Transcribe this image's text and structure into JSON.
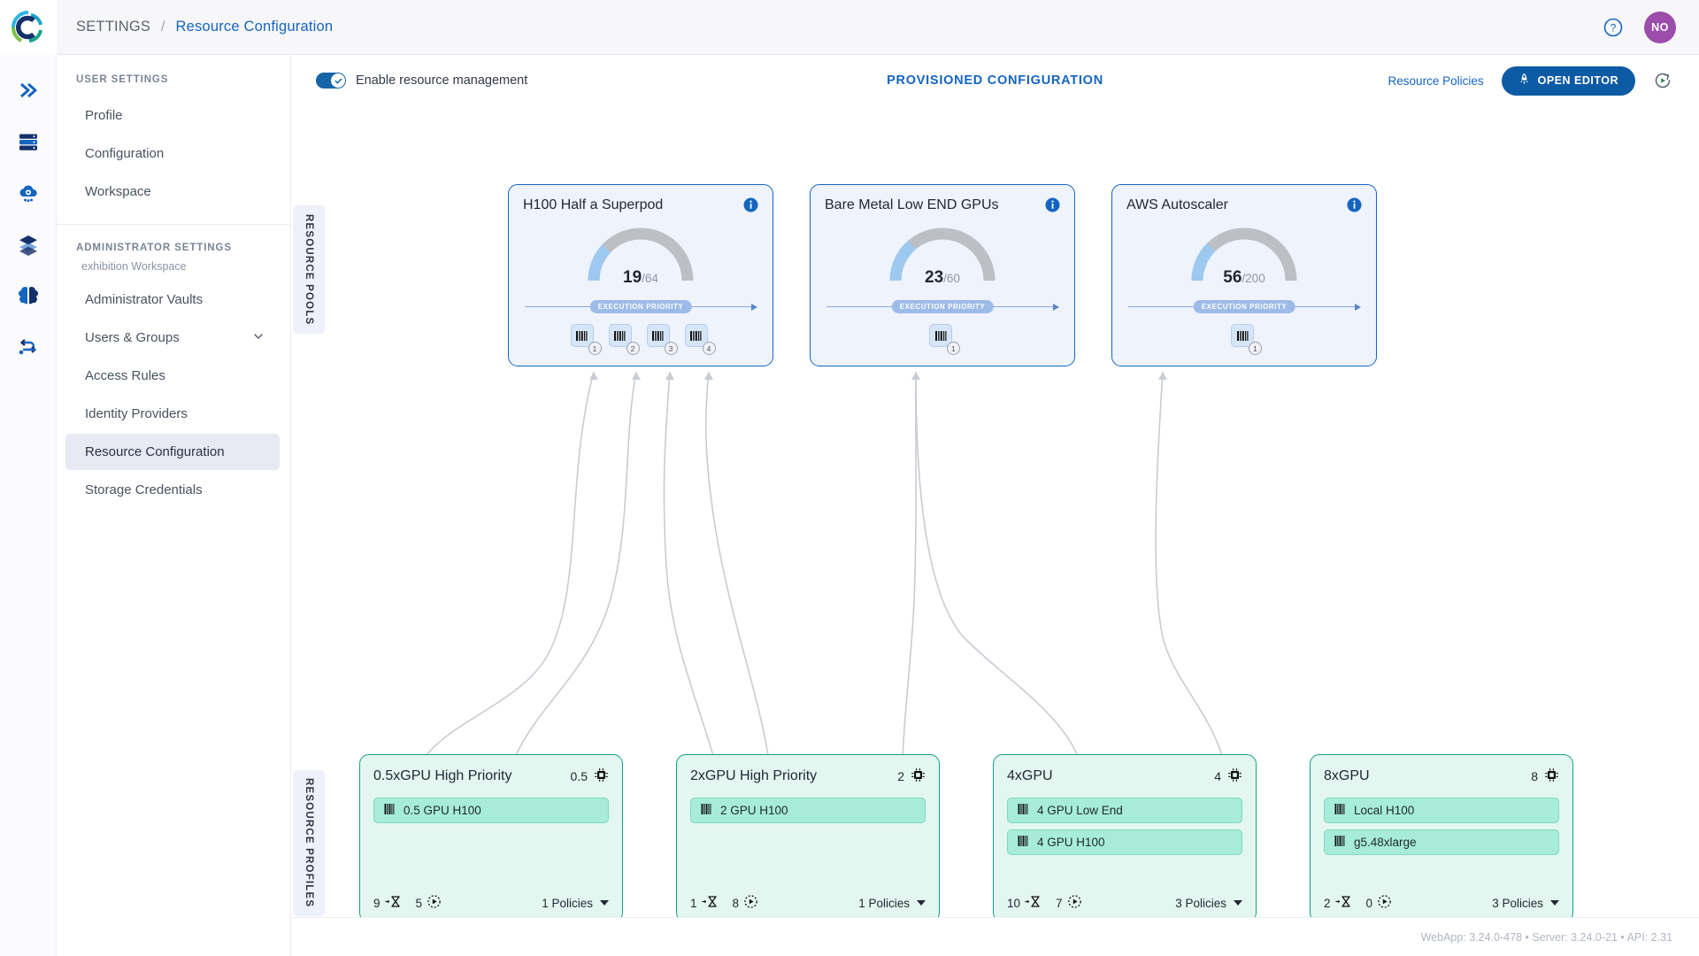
{
  "header": {
    "breadcrumb_root": "SETTINGS",
    "breadcrumb_sep": "/",
    "breadcrumb_current": "Resource Configuration",
    "help_icon": "help-circle-icon",
    "avatar_initials": "NO"
  },
  "rail": {
    "items": [
      {
        "icon": "double-chevron-right-icon",
        "name": "rail-item-collapse"
      },
      {
        "icon": "server-rack-icon",
        "name": "rail-item-compute"
      },
      {
        "icon": "cloud-gear-icon",
        "name": "rail-item-cloud"
      },
      {
        "icon": "layers-icon",
        "name": "rail-item-datasets"
      },
      {
        "icon": "brain-icon",
        "name": "rail-item-models"
      },
      {
        "icon": "pipeline-icon",
        "name": "rail-item-workflows"
      }
    ]
  },
  "nav": {
    "user_settings_label": "USER SETTINGS",
    "user_items": [
      {
        "label": "Profile"
      },
      {
        "label": "Configuration"
      },
      {
        "label": "Workspace"
      }
    ],
    "admin_settings_label": "ADMINISTRATOR SETTINGS",
    "admin_workspace": "exhibition Workspace",
    "admin_items": [
      {
        "label": "Administrator Vaults",
        "selected": false,
        "expandable": false
      },
      {
        "label": "Users & Groups",
        "selected": false,
        "expandable": true
      },
      {
        "label": "Access Rules",
        "selected": false,
        "expandable": false
      },
      {
        "label": "Identity Providers",
        "selected": false,
        "expandable": false
      },
      {
        "label": "Resource Configuration",
        "selected": true,
        "expandable": false
      },
      {
        "label": "Storage Credentials",
        "selected": false,
        "expandable": false
      }
    ]
  },
  "toolbar": {
    "toggle_label": "Enable resource management",
    "toggle_on": true,
    "center_title": "PROVISIONED CONFIGURATION",
    "resource_policies_label": "Resource Policies",
    "open_editor_label": "OPEN EDITOR",
    "open_editor_icon": "rocket-icon",
    "refresh_icon": "refresh-play-icon"
  },
  "sections": {
    "pools_label": "RESOURCE POOLS",
    "profiles_label": "RESOURCE PROFILES",
    "priority_label": "EXECUTION PRIORITY"
  },
  "pools": [
    {
      "title": "H100 Half a Superpod",
      "used": "19",
      "total": "/64",
      "used_num": 19,
      "total_num": 64,
      "chips": [
        "1",
        "2",
        "3",
        "4"
      ]
    },
    {
      "title": "Bare Metal Low END GPUs",
      "used": "23",
      "total": "/60",
      "used_num": 23,
      "total_num": 60,
      "chips": [
        "1"
      ]
    },
    {
      "title": "AWS Autoscaler",
      "used": "56",
      "total": "/200",
      "used_num": 56,
      "total_num": 200,
      "chips": [
        "1"
      ]
    }
  ],
  "profiles": [
    {
      "title": "0.5xGPU High Priority",
      "gpu_count": "0.5",
      "items": [
        "0.5 GPU H100"
      ],
      "queued": "9",
      "running": "5",
      "policies": "1 Policies"
    },
    {
      "title": "2xGPU High Priority",
      "gpu_count": "2",
      "items": [
        "2 GPU H100"
      ],
      "queued": "1",
      "running": "8",
      "policies": "1 Policies"
    },
    {
      "title": "4xGPU",
      "gpu_count": "4",
      "items": [
        "4 GPU Low End",
        "4 GPU H100"
      ],
      "queued": "10",
      "running": "7",
      "policies": "3 Policies"
    },
    {
      "title": "8xGPU",
      "gpu_count": "8",
      "items": [
        "Local H100",
        "g5.48xlarge"
      ],
      "queued": "2",
      "running": "0",
      "policies": "3 Policies"
    }
  ],
  "footer": {
    "version_text": "WebApp: 3.24.0-478 • Server: 3.24.0-21 • API: 2.31"
  },
  "colors": {
    "accent": "#1565c0",
    "pool_border": "#1565c0",
    "pool_fill": "#eef3fc",
    "profile_border": "#16a085",
    "profile_fill": "#e3f7f0",
    "gauge_fill": "#9dc8f0",
    "gauge_track": "#bcbfc4",
    "avatar": "#9c4dab"
  }
}
